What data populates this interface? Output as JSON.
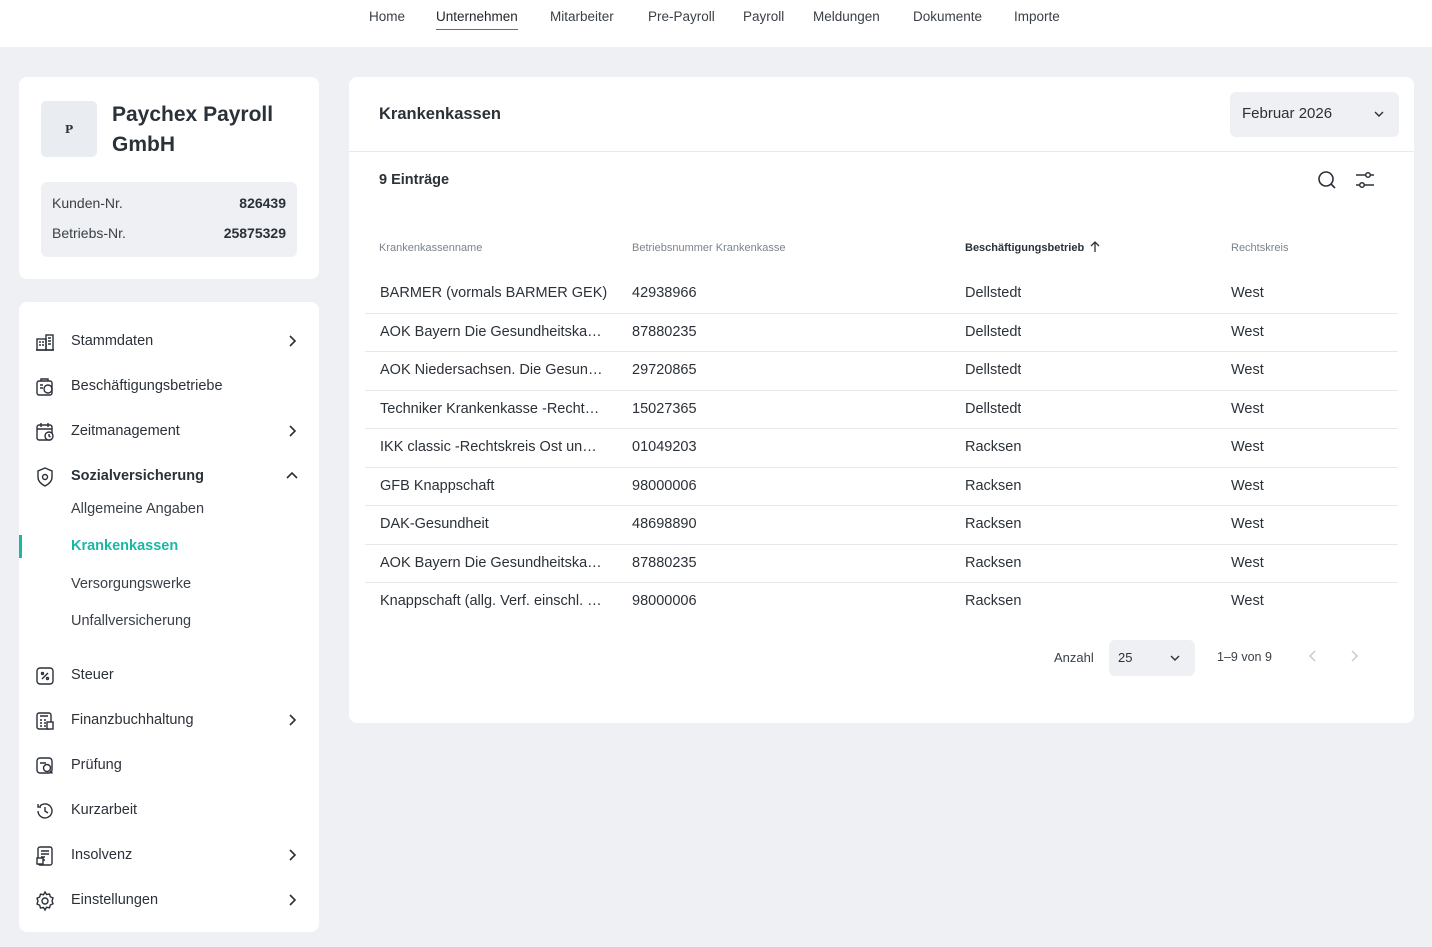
{
  "topnav": {
    "items": [
      "Home",
      "Unternehmen",
      "Mitarbeiter",
      "Pre-Payroll",
      "Payroll",
      "Meldungen",
      "Dokumente",
      "Importe"
    ],
    "active": "Unternehmen"
  },
  "company": {
    "logo_letter": "P",
    "name": "Paychex Payroll GmbH",
    "customer_label": "Kunden-Nr.",
    "customer_no": "826439",
    "company_label": "Betriebs-Nr.",
    "company_no": "25875329"
  },
  "sidebar": {
    "items": [
      {
        "label": "Stammdaten",
        "icon": "building-icon"
      },
      {
        "label": "Beschäftigungsbetriebe",
        "icon": "office-cycle-icon"
      },
      {
        "label": "Zeitmanagement",
        "icon": "calendar-clock-icon"
      },
      {
        "label": "Sozialversicherung",
        "icon": "shield-icon"
      },
      {
        "label": "Steuer",
        "icon": "tax-percent-icon"
      },
      {
        "label": "Finanzbuchhaltung",
        "icon": "calculator-icon"
      },
      {
        "label": "Prüfung",
        "icon": "audit-search-icon"
      },
      {
        "label": "Kurzarbeit",
        "icon": "clock-history-icon"
      },
      {
        "label": "Insolvenz",
        "icon": "document-list-icon"
      },
      {
        "label": "Einstellungen",
        "icon": "gear-icon"
      }
    ],
    "subitems": [
      "Allgemeine Angaben",
      "Krankenkassen",
      "Versorgungswerke",
      "Unfallversicherung"
    ],
    "active_subitem": "Krankenkassen"
  },
  "main": {
    "title": "Krankenkassen",
    "month": "Februar 2026",
    "entries": "9 Einträge",
    "columns": [
      "Krankenkassenname",
      "Betriebsnummer Krankenkasse",
      "Beschäftigungsbetrieb",
      "Rechtskreis"
    ],
    "rows": [
      [
        "BARMER (vormals BARMER GEK)",
        "42938966",
        "Dellstedt",
        "West"
      ],
      [
        "AOK Bayern Die Gesundheitskasse",
        "87880235",
        "Dellstedt",
        "West"
      ],
      [
        "AOK Niedersachsen. Die Gesundheitskasse",
        "29720865",
        "Dellstedt",
        "West"
      ],
      [
        "Techniker Krankenkasse -Rechtskreis West und Ost-",
        "15027365",
        "Dellstedt",
        "West"
      ],
      [
        "IKK classic -Rechtskreis Ost und West-",
        "01049203",
        "Racksen",
        "West"
      ],
      [
        "GFB Knappschaft",
        "98000006",
        "Racksen",
        "West"
      ],
      [
        "DAK-Gesundheit",
        "48698890",
        "Racksen",
        "West"
      ],
      [
        "AOK Bayern Die Gesundheitskasse",
        "87880235",
        "Racksen",
        "West"
      ],
      [
        "Knappschaft (allg. Verf. einschl. Minijob)",
        "98000006",
        "Racksen",
        "West"
      ]
    ],
    "pagination": {
      "label": "Anzahl",
      "page_size": "25",
      "range": "1–9 von 9"
    }
  },
  "colors": {
    "accent": "#19b8a5",
    "nav_underline": "#1d8f80",
    "background": "#eef0f3"
  }
}
